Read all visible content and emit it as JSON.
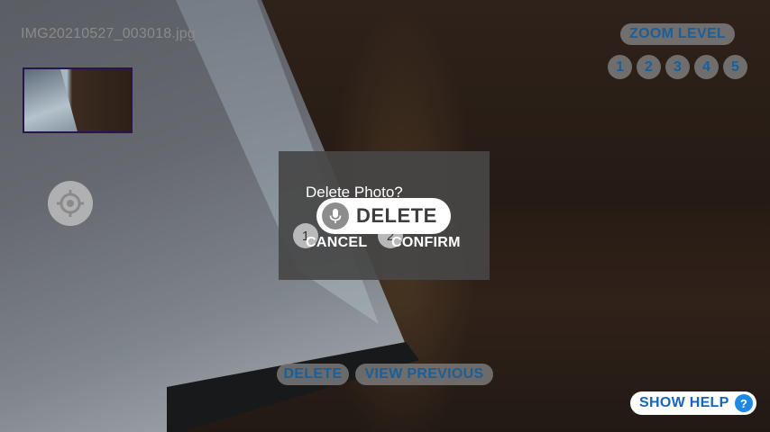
{
  "photo": {
    "filename": "IMG20210527_003018.jpg"
  },
  "zoom": {
    "label": "ZOOM LEVEL",
    "levels": [
      "1",
      "2",
      "3",
      "4",
      "5"
    ]
  },
  "icons": {
    "target": "target-crosshair-icon",
    "mic": "microphone-icon",
    "help": "help-question-icon"
  },
  "dialog": {
    "title": "Delete Photo?",
    "cancel_number": "1",
    "cancel_label": "CANCEL",
    "confirm_number": "2",
    "confirm_label": "CONFIRM"
  },
  "voice_command": {
    "text": "DELETE"
  },
  "actions": {
    "delete_label": "DELETE",
    "view_previous_label": "VIEW PREVIOUS"
  },
  "help": {
    "label": "SHOW HELP",
    "icon_glyph": "?"
  },
  "colors": {
    "accent_text": "#1c5f98",
    "help_blue": "#1e88e5",
    "dialog_bg": "#464646",
    "thumb_border": "#2a1450"
  }
}
